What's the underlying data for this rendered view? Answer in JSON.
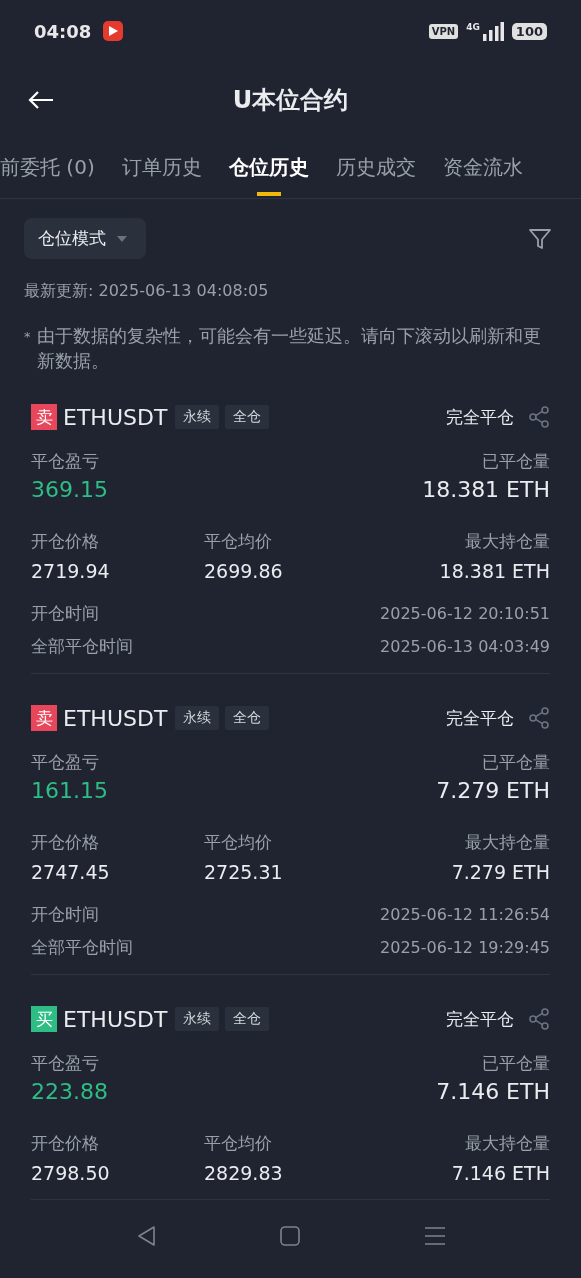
{
  "status_bar": {
    "time": "04:08",
    "vpn": "VPN",
    "network": "4G",
    "battery": "100"
  },
  "header": {
    "title": "U本位合约"
  },
  "tabs": [
    {
      "label": "前委托 (0)",
      "selected": false
    },
    {
      "label": "订单历史",
      "selected": false
    },
    {
      "label": "仓位历史",
      "selected": true
    },
    {
      "label": "历史成交",
      "selected": false
    },
    {
      "label": "资金流水",
      "selected": false
    }
  ],
  "mode_dropdown": {
    "label": "仓位模式"
  },
  "last_update": "最新更新: 2025-06-13 04:08:05",
  "notice": {
    "mark": "*",
    "text": "由于数据的复杂性，可能会有一些延迟。请向下滚动以刷新和更新数据。"
  },
  "positions": [
    {
      "kind": "sell",
      "side_label": "卖",
      "symbol": "ETHUSDT",
      "tags": [
        "永续",
        "全仓"
      ],
      "status": "完全平仓",
      "pnl_label": "平仓盈亏",
      "pnl": "369.15",
      "closed_label": "已平仓量",
      "closed": "18.381 ETH",
      "stats": [
        {
          "label": "开仓价格",
          "value": "2719.94"
        },
        {
          "label": "平仓均价",
          "value": "2699.86"
        },
        {
          "label": "最大持仓量",
          "value": "18.381 ETH"
        }
      ],
      "times": [
        {
          "label": "开仓时间",
          "value": "2025-06-12 20:10:51"
        },
        {
          "label": "全部平仓时间",
          "value": "2025-06-13 04:03:49"
        }
      ]
    },
    {
      "kind": "sell",
      "side_label": "卖",
      "symbol": "ETHUSDT",
      "tags": [
        "永续",
        "全仓"
      ],
      "status": "完全平仓",
      "pnl_label": "平仓盈亏",
      "pnl": "161.15",
      "closed_label": "已平仓量",
      "closed": "7.279 ETH",
      "stats": [
        {
          "label": "开仓价格",
          "value": "2747.45"
        },
        {
          "label": "平仓均价",
          "value": "2725.31"
        },
        {
          "label": "最大持仓量",
          "value": "7.279 ETH"
        }
      ],
      "times": [
        {
          "label": "开仓时间",
          "value": "2025-06-12 11:26:54"
        },
        {
          "label": "全部平仓时间",
          "value": "2025-06-12 19:29:45"
        }
      ]
    },
    {
      "kind": "buy",
      "side_label": "买",
      "symbol": "ETHUSDT",
      "tags": [
        "永续",
        "全仓"
      ],
      "status": "完全平仓",
      "pnl_label": "平仓盈亏",
      "pnl": "223.88",
      "closed_label": "已平仓量",
      "closed": "7.146 ETH",
      "stats": [
        {
          "label": "开仓价格",
          "value": "2798.50"
        },
        {
          "label": "平仓均价",
          "value": "2829.83"
        },
        {
          "label": "最大持仓量",
          "value": "7.146 ETH"
        }
      ]
    }
  ]
}
